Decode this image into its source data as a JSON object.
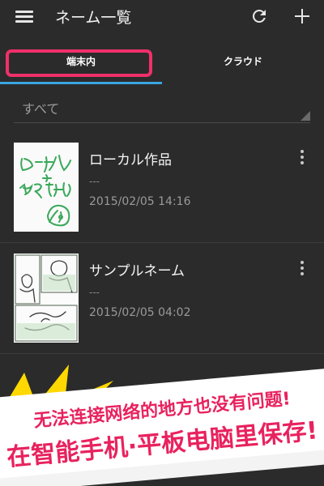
{
  "app_bar": {
    "title": "ネーム一覧",
    "icons": [
      "menu-icon",
      "refresh-icon",
      "add-icon"
    ]
  },
  "tabs": [
    {
      "label": "端末内",
      "selected": true
    },
    {
      "label": "クラウド",
      "selected": false
    }
  ],
  "filter": {
    "selected": "すべて"
  },
  "items": [
    {
      "title": "ローカル作品",
      "subtitle": "---",
      "date": "2015/02/05 14:16"
    },
    {
      "title": "サンプルネーム",
      "subtitle": "---",
      "date": "2015/02/05 04:02"
    }
  ],
  "promo": {
    "line1": "无法连接网络的地方也没有问题!",
    "line2": "在智能手机·平板电脑里保存!"
  },
  "colors": {
    "background": "#2b2b2b",
    "tab_indicator": "#39a6e0",
    "highlight": "#f0306a",
    "promo_text": "#e8225e",
    "burst": "#ffd800"
  }
}
